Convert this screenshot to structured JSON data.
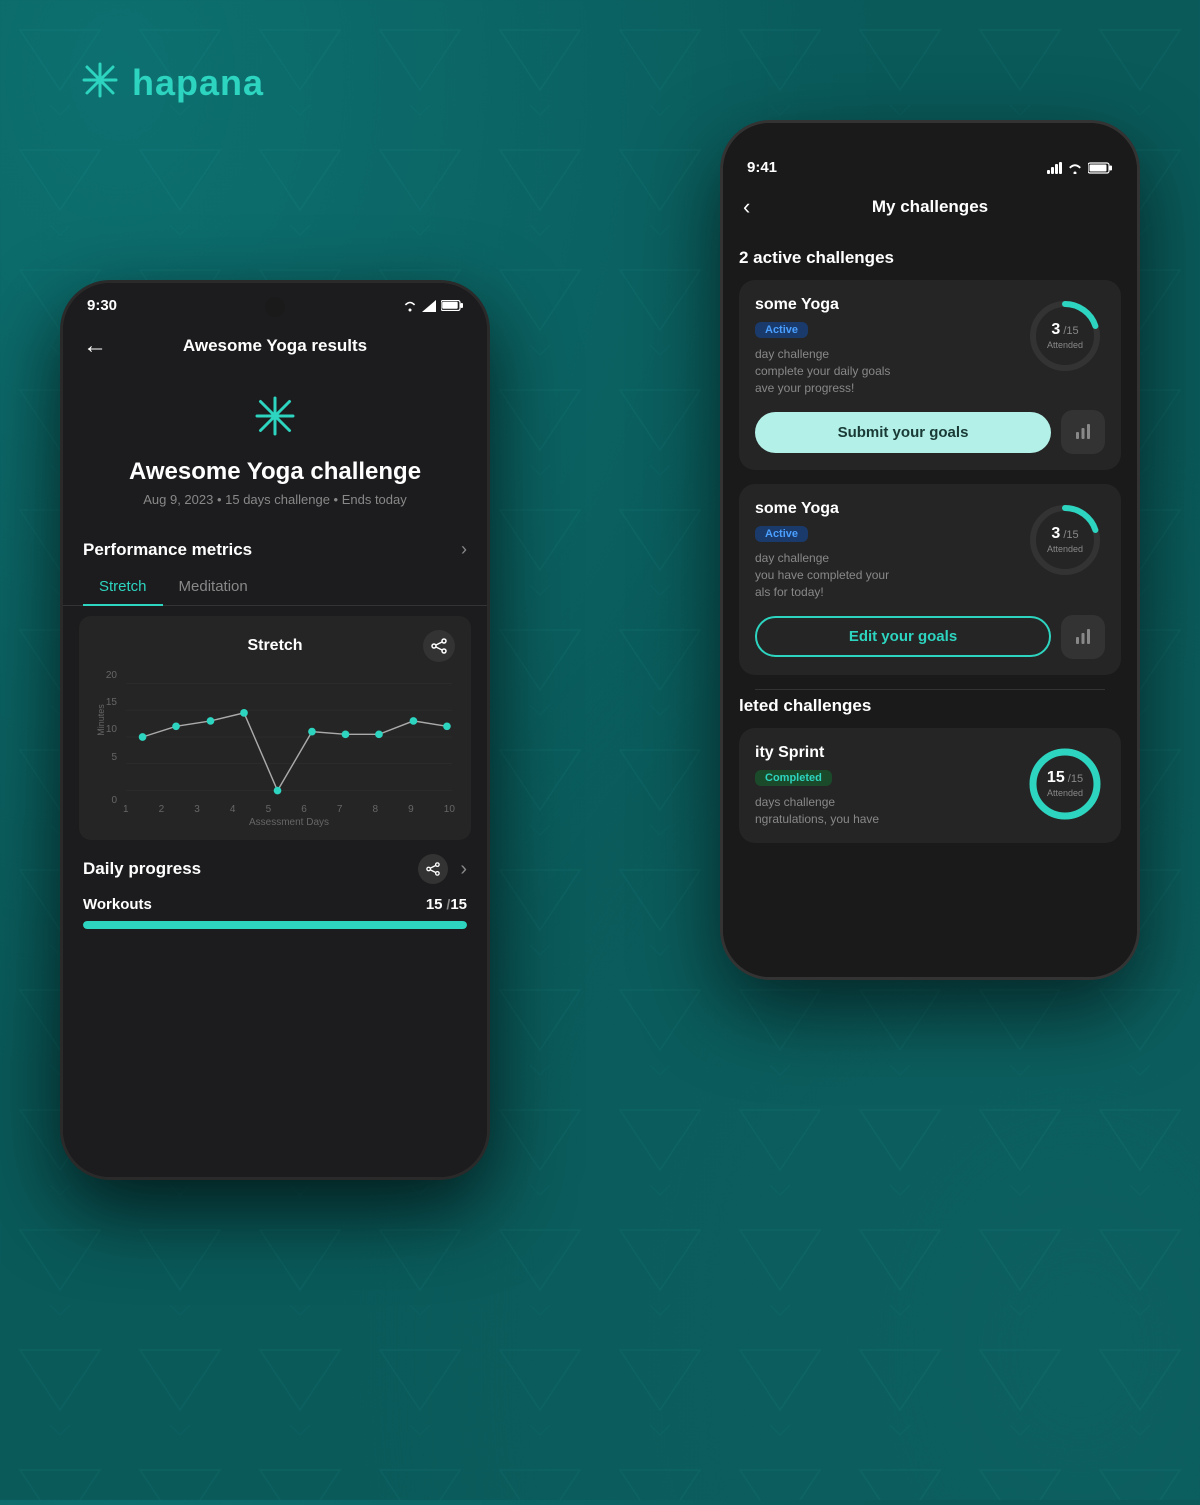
{
  "brand": {
    "name": "hapana",
    "color": "#2dd4bf"
  },
  "background": {
    "color": "#0a5a5a"
  },
  "phone_back": {
    "status": {
      "time": "9:41",
      "signal": "full",
      "wifi": "on",
      "battery": "full"
    },
    "nav": {
      "back_label": "‹",
      "title": "My challenges"
    },
    "active_section": {
      "title": "2 active challenges"
    },
    "challenge1": {
      "name": "some Yoga",
      "badge": "Active",
      "badge_type": "active",
      "type": "day challenge",
      "desc_line1": "complete your daily goals",
      "desc_line2": "ave your progress!",
      "attended_current": "3",
      "attended_total": "15",
      "attended_label": "Attended",
      "progress_pct": 20,
      "submit_label": "Submit your goals",
      "stats_icon": "chart-icon"
    },
    "challenge2": {
      "name": "some Yoga",
      "badge": "Active",
      "badge_type": "active",
      "type": "day challenge",
      "desc_line1": "you have completed your",
      "desc_line2": "als for today!",
      "attended_current": "3",
      "attended_total": "15",
      "attended_label": "Attended",
      "progress_pct": 20,
      "edit_label": "Edit your goals",
      "stats_icon": "chart-icon"
    },
    "completed_section": {
      "title": "leted challenges"
    },
    "challenge3": {
      "name": "ity Sprint",
      "badge": "Completed",
      "badge_type": "completed",
      "type": "days challenge",
      "desc": "ngratulations, you have",
      "attended_current": "15",
      "attended_total": "15",
      "attended_label": "Attended",
      "progress_pct": 100
    }
  },
  "phone_front": {
    "status": {
      "time": "9:30",
      "wifi": "on",
      "battery": "full"
    },
    "nav": {
      "back_label": "←",
      "title": "Awesome Yoga results"
    },
    "challenge": {
      "icon": "✳",
      "title": "Awesome Yoga challenge",
      "subtitle": "Aug 9, 2023  •  15 days challenge  •  Ends today"
    },
    "performance": {
      "title": "Performance metrics",
      "tab1": "Stretch",
      "tab2": "Meditation",
      "chart_title": "Stretch",
      "y_labels": [
        "20",
        "15",
        "10",
        "5",
        "0"
      ],
      "y_axis_title": "Minutes",
      "x_labels": [
        "1",
        "2",
        "3",
        "4",
        "5",
        "6",
        "7",
        "8",
        "9",
        "10"
      ],
      "x_axis_title": "Assessment Days",
      "data_points": [
        {
          "x": 1,
          "y": 10
        },
        {
          "x": 2,
          "y": 12
        },
        {
          "x": 3,
          "y": 13
        },
        {
          "x": 4,
          "y": 14.5
        },
        {
          "x": 5,
          "y": 0
        },
        {
          "x": 6,
          "y": 11
        },
        {
          "x": 7,
          "y": 10.5
        },
        {
          "x": 8,
          "y": 10.5
        },
        {
          "x": 9,
          "y": 13
        },
        {
          "x": 10,
          "y": 12
        }
      ]
    },
    "daily_progress": {
      "title": "Daily progress",
      "share_icon": "share-icon",
      "arrow_icon": "›",
      "workouts_label": "Workouts",
      "workouts_current": "15",
      "workouts_total": "15",
      "progress_pct": 100
    }
  }
}
